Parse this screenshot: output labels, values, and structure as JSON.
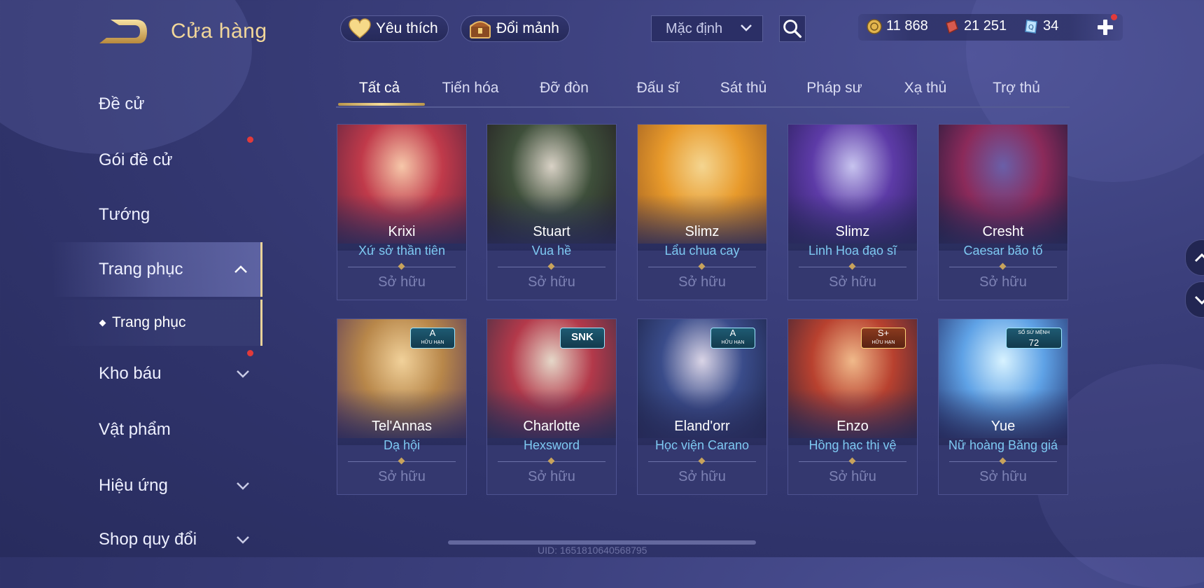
{
  "header": {
    "title": "Cửa hàng",
    "favorites_label": "Yêu thích",
    "exchange_label": "Đổi mảnh",
    "sort_value": "Mặc định"
  },
  "currency": {
    "gold": "11 868",
    "vouchers": "21 251",
    "quan_huy": "34"
  },
  "sidebar": {
    "items": [
      {
        "label": "Đề cử"
      },
      {
        "label": "Gói đề cử"
      },
      {
        "label": "Tướng"
      },
      {
        "label": "Trang phục"
      },
      {
        "label": "Trang phục"
      },
      {
        "label": "Kho báu"
      },
      {
        "label": "Vật phẩm"
      },
      {
        "label": "Hiệu ứng"
      },
      {
        "label": "Shop quy đổi"
      }
    ]
  },
  "tabs": [
    "Tất cả",
    "Tiến hóa",
    "Đỡ đòn",
    "Đấu sĩ",
    "Sát thủ",
    "Pháp sư",
    "Xạ thủ",
    "Trợ thủ"
  ],
  "cards": [
    {
      "hero": "Krixi",
      "skin": "Xứ sở thần tiên",
      "status": "Sở hữu",
      "art": [
        "#f6c7a9",
        "#c03a4a",
        "#5b2340"
      ]
    },
    {
      "hero": "Stuart",
      "skin": "Vua hề",
      "status": "Sở hữu",
      "art": [
        "#d8d1c5",
        "#3e4f3a",
        "#231d22"
      ]
    },
    {
      "hero": "Slimz",
      "skin": "Lẩu chua cay",
      "status": "Sở hữu",
      "art": [
        "#f4d590",
        "#e89a2b",
        "#9a5b22"
      ]
    },
    {
      "hero": "Slimz",
      "skin": "Linh Hoa đạo sĩ",
      "status": "Sở hữu",
      "art": [
        "#c7c3ef",
        "#5d3ba7",
        "#2a1f5c"
      ]
    },
    {
      "hero": "Cresht",
      "skin": "Caesar bão tố",
      "status": "Sở hữu",
      "art": [
        "#6a5fa8",
        "#8b2a5a",
        "#1c1a3b"
      ]
    },
    {
      "hero": "Tel'Annas",
      "skin": "Dạ hội",
      "status": "Sở hữu",
      "art": [
        "#f1d19a",
        "#b8874a",
        "#5a3a5a"
      ],
      "badge": "A",
      "badge_sub": "HỮU HẠN"
    },
    {
      "hero": "Charlotte",
      "skin": "Hexsword",
      "status": "Sở hữu",
      "art": [
        "#e5d7c8",
        "#b3394a",
        "#3f2f45"
      ],
      "badge": "SNK",
      "badge_sub": ""
    },
    {
      "hero": "Eland'orr",
      "skin": "Học viện Carano",
      "status": "Sở hữu",
      "art": [
        "#d9d4e6",
        "#3a4c8a",
        "#1c2247"
      ],
      "badge": "A",
      "badge_sub": "HỮU HẠN"
    },
    {
      "hero": "Enzo",
      "skin": "Hồng hạc thị vệ",
      "status": "Sở hữu",
      "art": [
        "#f0b98a",
        "#b8412f",
        "#3a2336"
      ],
      "badge": "S+",
      "badge_sub": "HỮU HẠN"
    },
    {
      "hero": "Yue",
      "skin": "Nữ hoàng Băng giá",
      "status": "Sở hữu",
      "art": [
        "#d7f2ff",
        "#5fa2e6",
        "#23306b"
      ],
      "badge": "72",
      "badge_sub": "SỐ SỨ MỆNH"
    }
  ],
  "footer": {
    "uid": "UID: 1651810640568795"
  }
}
